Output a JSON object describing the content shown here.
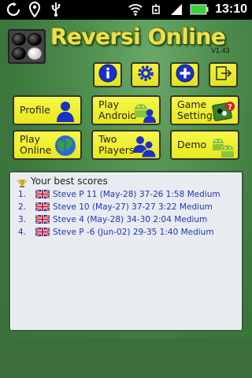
{
  "status_bar": {
    "time": "13:10",
    "left_icons": [
      "sync-icon",
      "location-icon",
      "usb-icon"
    ],
    "right_icons": [
      "wifi-icon",
      "sound-icon",
      "signal-icon",
      "battery-icon"
    ]
  },
  "header": {
    "title": "Reversi Online",
    "version": "V1.43"
  },
  "toolbar": {
    "buttons": [
      {
        "name": "info-button",
        "icon": "info-icon"
      },
      {
        "name": "settings-button",
        "icon": "gear-icon"
      },
      {
        "name": "add-button",
        "icon": "plus-icon"
      },
      {
        "name": "exit-button",
        "icon": "exit-icon"
      }
    ]
  },
  "menu": {
    "profile": "Profile",
    "play_android": "Play\nAndroid",
    "game_settings": "Game\nSettings",
    "play_online": "Play\nOnline",
    "two_players": "Two\nPlayers",
    "demo": "Demo"
  },
  "scores": {
    "title": "Your best scores",
    "rows": [
      {
        "rank": "1.",
        "text": "Steve P  11  (May-28) 37-26 1:58  Medium"
      },
      {
        "rank": "2.",
        "text": "Steve  10  (May-27) 37-27 3:22  Medium"
      },
      {
        "rank": "3.",
        "text": "Steve  4  (May-28) 34-30 2:04  Medium"
      },
      {
        "rank": "4.",
        "text": "Steve P  -6  (Jun-02) 29-35 1:40  Medium"
      }
    ]
  },
  "colors": {
    "button": "#f0f030",
    "text_link": "#2233bb",
    "background": "#4a8a4a"
  }
}
